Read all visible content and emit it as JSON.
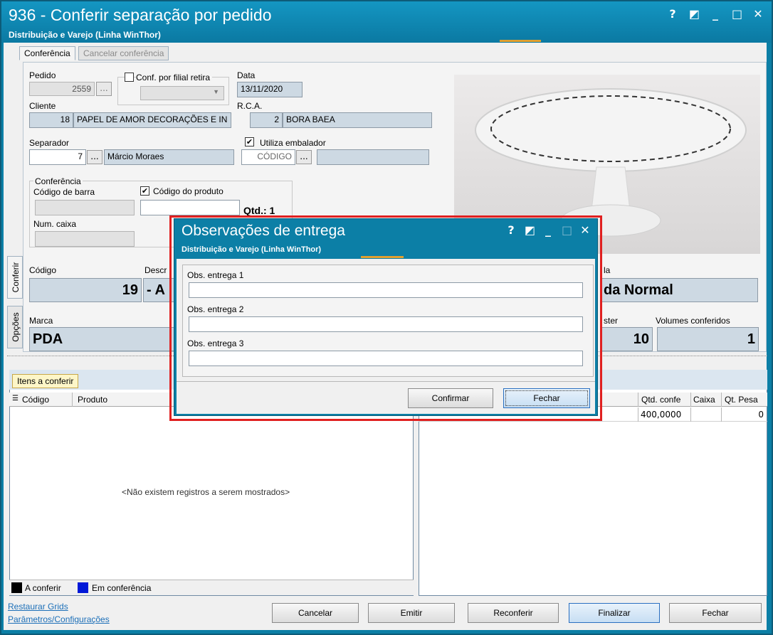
{
  "window": {
    "title": "936 - Conferir separação por pedido",
    "subtitle": "Distribuição e Varejo (Linha WinThor)",
    "controls": [
      "?",
      "◩",
      "_",
      "□",
      "✕"
    ]
  },
  "tabs": {
    "main": [
      "Conferência",
      "Cancelar conferência"
    ],
    "side": [
      "Conferir",
      "Opções"
    ]
  },
  "form": {
    "pedido_label": "Pedido",
    "pedido_value": "2559",
    "ellipsis": "...",
    "conf_filial_label": "Conf. por filial retira",
    "data_label": "Data",
    "data_value": "13/11/2020",
    "cliente_label": "Cliente",
    "cliente_code": "18",
    "cliente_name": "PAPEL DE AMOR DECORAÇÕES E IN",
    "rca_label": "R.C.A.",
    "rca_code": "2",
    "rca_name": "BORA BAEA",
    "separador_label": "Separador",
    "separador_code": "7",
    "separador_name": "Márcio Moraes",
    "utiliza_embalador_label": "Utiliza embalador",
    "codigo_placeholder": "CÓDIGO",
    "conferencia_group": "Conferência",
    "codigo_barra_label": "Código de barra",
    "codigo_produto_label": "Código do produto",
    "qtd_label": "Qtd.: 1",
    "num_caixa_label": "Num. caixa",
    "codigo_label": "Código",
    "codigo_value": "19",
    "descricao_label": "Descr",
    "descricao_value": "- A",
    "embalagem_label_partial": "la",
    "embalagem_value": "da Normal",
    "marca_label": "Marca",
    "marca_value": "PDA",
    "master_label_partial": "ster",
    "master_value": "10",
    "volumes_label": "Volumes conferidos",
    "volumes_value": "1"
  },
  "grid_left": {
    "tab": "Itens a conferir",
    "columns": [
      "Código",
      "Produto"
    ],
    "empty_message": "<Não existem registros a serem mostrados>",
    "legend": [
      {
        "label": "A conferir",
        "color": "#000000"
      },
      {
        "label": "Em conferência",
        "color": "#0018d8"
      }
    ]
  },
  "grid_right": {
    "columns": [
      "Qtd. confe",
      "Caixa",
      "Qt. Pesa"
    ],
    "row": [
      "400,0000",
      "",
      "0"
    ]
  },
  "footer": {
    "links": [
      "Restaurar Grids",
      "Parâmetros/Configurações"
    ],
    "buttons": [
      "Cancelar",
      "Emitir",
      "Reconferir",
      "Finalizar",
      "Fechar"
    ]
  },
  "dialog": {
    "title": "Observações de entrega",
    "subtitle": "Distribuição e Varejo (Linha WinThor)",
    "controls": [
      "?",
      "◩",
      "_",
      "□",
      "✕"
    ],
    "fields": [
      {
        "label": "Obs. entrega 1",
        "value": ""
      },
      {
        "label": "Obs. entrega 2",
        "value": ""
      },
      {
        "label": "Obs. entrega 3",
        "value": ""
      }
    ],
    "confirm_label": "Confirmar",
    "close_label": "Fechar"
  },
  "colors": {
    "titlebar": "#0c7fa6",
    "highlight_outline": "#e02020",
    "field_fill": "#cdd9e3",
    "link": "#1c6fb8"
  }
}
